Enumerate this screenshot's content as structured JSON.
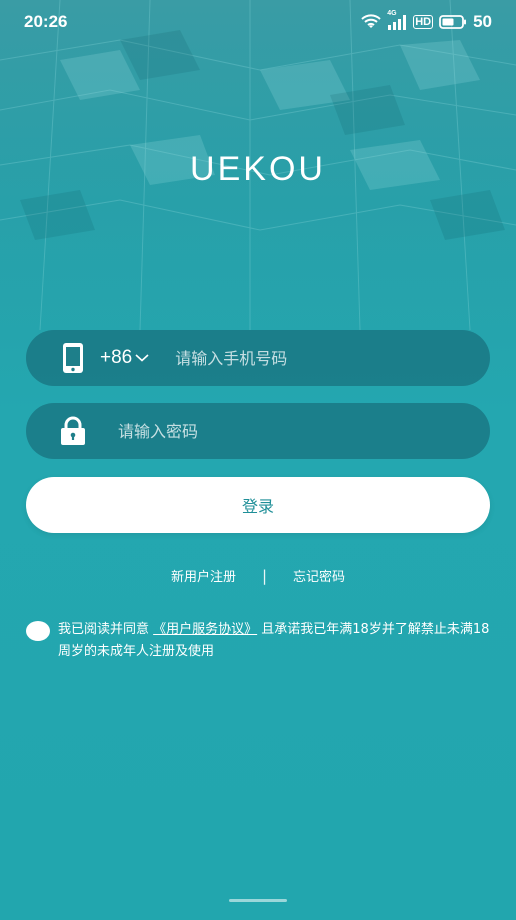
{
  "status_bar": {
    "time": "20:26",
    "network": "4G",
    "hd": "HD",
    "battery": "50"
  },
  "logo": {
    "text": "UEKOU"
  },
  "phone_field": {
    "country_code": "+86",
    "placeholder": "请输入手机号码"
  },
  "password_field": {
    "placeholder": "请输入密码"
  },
  "login_button": {
    "label": "登录"
  },
  "links": {
    "register": "新用户注册",
    "separator": "|",
    "forgot": "忘记密码"
  },
  "agreement": {
    "prefix": "我已阅读并同意 ",
    "link": "《用户服务协议》",
    "suffix": " 且承诺我已年满18岁并了解禁止未满18周岁的未成年人注册及使用"
  },
  "colors": {
    "background": "#24a7b0",
    "field": "#145f6e",
    "button_text": "#1f8f98"
  },
  "icons": [
    "wifi-icon",
    "signal-icon",
    "battery-icon",
    "phone-icon",
    "lock-icon",
    "chevron-down-icon"
  ]
}
